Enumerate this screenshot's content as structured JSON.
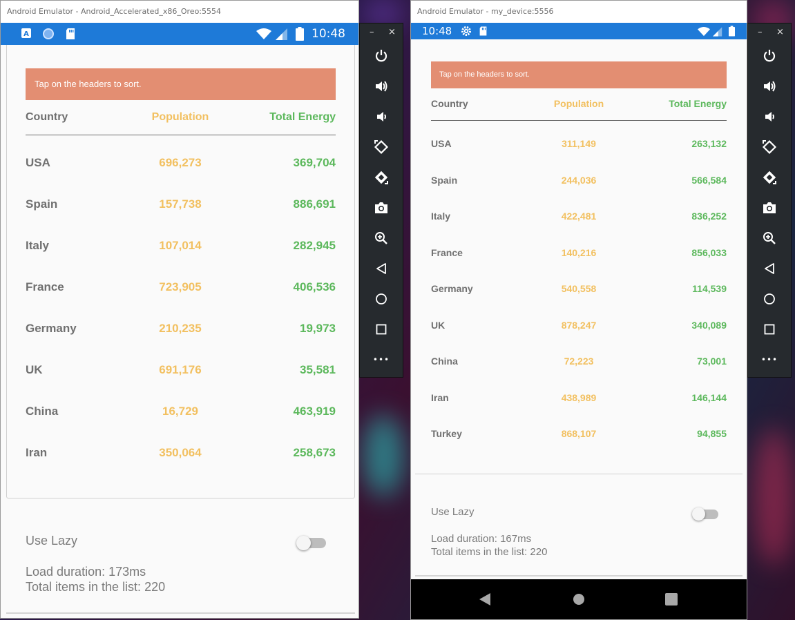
{
  "desktop": {
    "accent_colors": [
      "#1e7ad8",
      "#e38e72",
      "#f2c060",
      "#5cb85c"
    ]
  },
  "emulator_left": {
    "window_title": "Android Emulator - Android_Accelerated_x86_Oreo:5554",
    "status": {
      "time": "10:48",
      "icons": [
        "app-a-icon",
        "circle-app-icon",
        "sd-card-icon",
        "wifi-icon",
        "signal-icon",
        "battery-icon"
      ]
    },
    "banner_text": "Tap on the headers to sort.",
    "headers": {
      "country": "Country",
      "population": "Population",
      "energy": "Total Energy"
    },
    "rows": [
      {
        "country": "USA",
        "population": "696,273",
        "energy": "369,704"
      },
      {
        "country": "Spain",
        "population": "157,738",
        "energy": "886,691"
      },
      {
        "country": "Italy",
        "population": "107,014",
        "energy": "282,945"
      },
      {
        "country": "France",
        "population": "723,905",
        "energy": "406,536"
      },
      {
        "country": "Germany",
        "population": "210,235",
        "energy": "19,973"
      },
      {
        "country": "UK",
        "population": "691,176",
        "energy": "35,581"
      },
      {
        "country": "China",
        "population": "16,729",
        "energy": "463,919"
      },
      {
        "country": "Iran",
        "population": "350,064",
        "energy": "258,673"
      }
    ],
    "use_lazy_label": "Use Lazy",
    "use_lazy_on": false,
    "load_duration": "Load duration: 173ms",
    "total_items": "Total items in the list: 220"
  },
  "emulator_right": {
    "window_title": "Android Emulator - my_device:5556",
    "status": {
      "time": "10:48",
      "icons": [
        "gear-icon",
        "sd-card-icon",
        "wifi-icon",
        "signal-icon",
        "battery-icon"
      ]
    },
    "banner_text": "Tap on the headers to sort.",
    "headers": {
      "country": "Country",
      "population": "Population",
      "energy": "Total Energy"
    },
    "rows": [
      {
        "country": "USA",
        "population": "311,149",
        "energy": "263,132"
      },
      {
        "country": "Spain",
        "population": "244,036",
        "energy": "566,584"
      },
      {
        "country": "Italy",
        "population": "422,481",
        "energy": "836,252"
      },
      {
        "country": "France",
        "population": "140,216",
        "energy": "856,033"
      },
      {
        "country": "Germany",
        "population": "540,558",
        "energy": "114,539"
      },
      {
        "country": "UK",
        "population": "878,247",
        "energy": "340,089"
      },
      {
        "country": "China",
        "population": "72,223",
        "energy": "73,001"
      },
      {
        "country": "Iran",
        "population": "438,989",
        "energy": "146,144"
      },
      {
        "country": "Turkey",
        "population": "868,107",
        "energy": "94,855"
      }
    ],
    "use_lazy_label": "Use Lazy",
    "use_lazy_on": false,
    "load_duration": "Load duration: 167ms",
    "total_items": "Total items in the list: 220",
    "nav_buttons": [
      "back-icon",
      "home-icon",
      "recents-icon"
    ]
  },
  "control_panel": {
    "top_buttons": {
      "minimize": "–",
      "close": "×"
    },
    "buttons": [
      "power-icon",
      "volume-up-icon",
      "volume-down-icon",
      "rotate-left-icon",
      "rotate-right-icon",
      "camera-icon",
      "zoom-icon",
      "back-icon",
      "home-icon",
      "overview-icon",
      "more-icon"
    ],
    "more_label": "•••"
  }
}
